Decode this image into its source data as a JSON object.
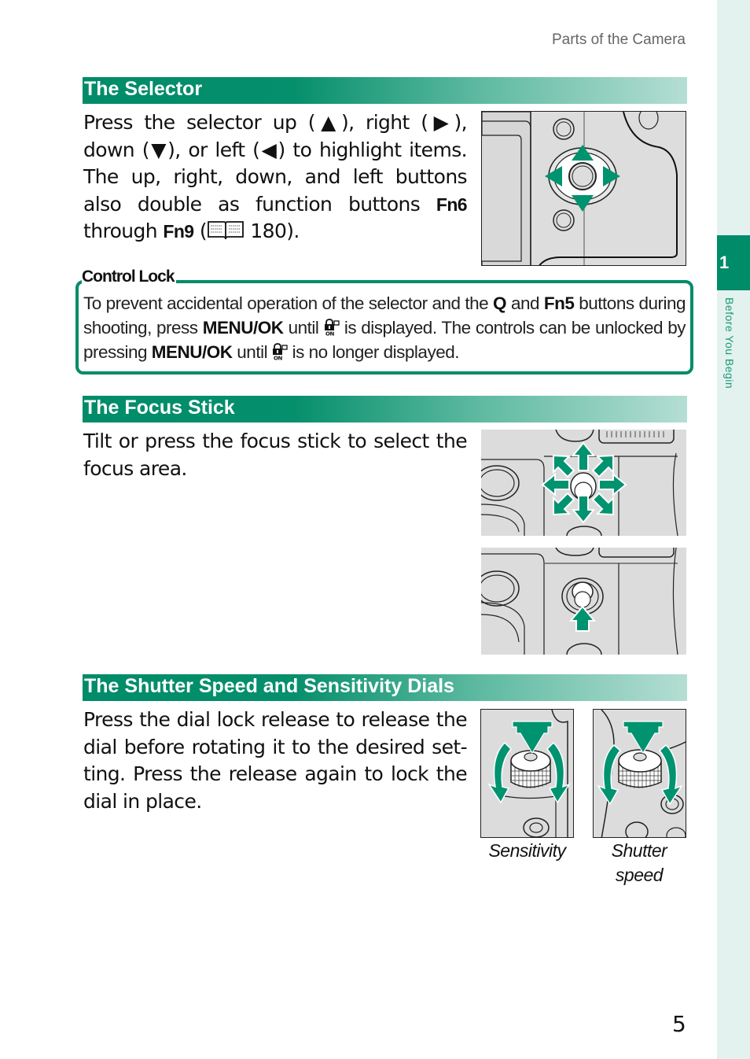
{
  "running_head": "Parts of the Camera",
  "chapter": {
    "number": "1",
    "label": "Before You Begin"
  },
  "sections": [
    {
      "title": "The Selector",
      "body": {
        "part1": "Press the selector up (▲), right (▶), down (▼), or left (◀) to highlight items. The up, right, down, and left buttons also double as function buttons ",
        "key1": "Fn6",
        "part2": " through ",
        "key2": "Fn9",
        "part3": " (",
        "page_ref": "180",
        "part4": ")."
      },
      "figure_icon": "selector-illustration"
    },
    {
      "title": "The Focus Stick",
      "body": "Tilt or press the focus stick to select the focus area.",
      "figures": [
        "focus-stick-tilt-illustration",
        "focus-stick-press-illustration"
      ]
    },
    {
      "title": "The Shutter Speed and Sensitivity Dials",
      "body": "Press the dial lock release to release the dial before rotating it to the desired set-ting. Press the release again to lock the dial in place.",
      "figures": [
        {
          "caption": "Sensitivity"
        },
        {
          "caption": "Shutter speed"
        }
      ]
    }
  ],
  "note": {
    "title": "Control Lock",
    "t1": "To prevent accidental operation of the selector and the ",
    "k1": "Q",
    "t2": " and ",
    "k2": "Fn5",
    "t3": " buttons during shooting, press ",
    "k3": "MENU/OK",
    "t4": " until ",
    "t5": " is displayed. The controls can be unlocked by pressing ",
    "k4": "MENU/OK",
    "t6": " until ",
    "t7": " is no longer displayed."
  },
  "page_number": "5",
  "colors": {
    "accent": "#008c69",
    "sidebar": "#e3f2ee",
    "gradient_end": "#b5ded3"
  }
}
